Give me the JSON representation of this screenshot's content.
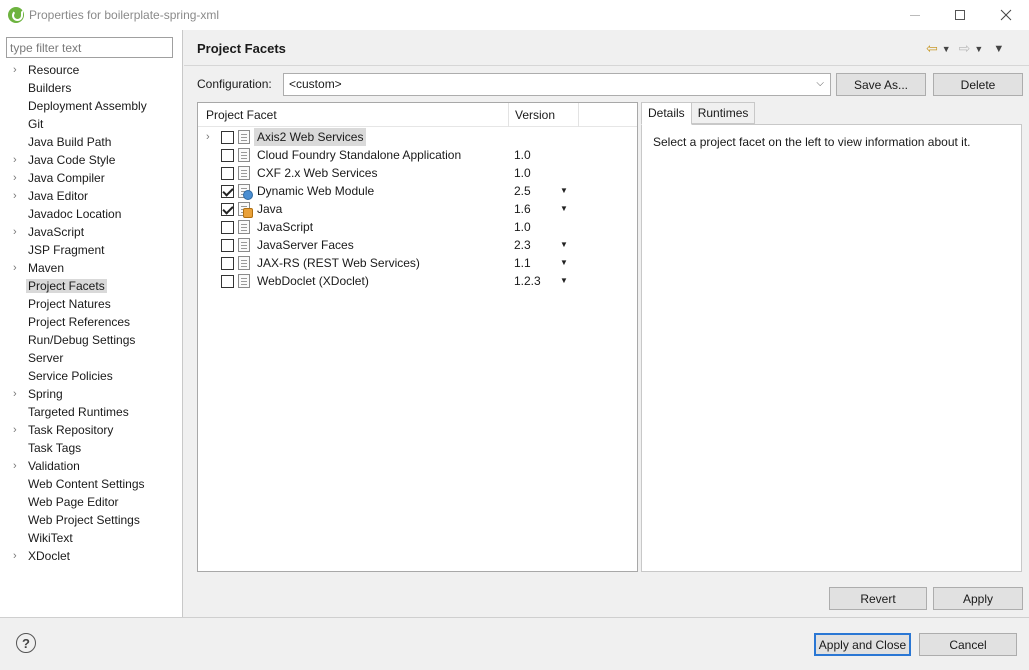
{
  "window": {
    "title": "Properties for boilerplate-spring-xml"
  },
  "sidebar": {
    "filter_placeholder": "type filter text",
    "items": [
      {
        "label": "Resource",
        "expandable": true
      },
      {
        "label": "Builders",
        "expandable": false
      },
      {
        "label": "Deployment Assembly",
        "expandable": false
      },
      {
        "label": "Git",
        "expandable": false
      },
      {
        "label": "Java Build Path",
        "expandable": false
      },
      {
        "label": "Java Code Style",
        "expandable": true
      },
      {
        "label": "Java Compiler",
        "expandable": true
      },
      {
        "label": "Java Editor",
        "expandable": true
      },
      {
        "label": "Javadoc Location",
        "expandable": false
      },
      {
        "label": "JavaScript",
        "expandable": true
      },
      {
        "label": "JSP Fragment",
        "expandable": false
      },
      {
        "label": "Maven",
        "expandable": true
      },
      {
        "label": "Project Facets",
        "expandable": false,
        "selected": true
      },
      {
        "label": "Project Natures",
        "expandable": false
      },
      {
        "label": "Project References",
        "expandable": false
      },
      {
        "label": "Run/Debug Settings",
        "expandable": false
      },
      {
        "label": "Server",
        "expandable": false
      },
      {
        "label": "Service Policies",
        "expandable": false
      },
      {
        "label": "Spring",
        "expandable": true
      },
      {
        "label": "Targeted Runtimes",
        "expandable": false
      },
      {
        "label": "Task Repository",
        "expandable": true
      },
      {
        "label": "Task Tags",
        "expandable": false
      },
      {
        "label": "Validation",
        "expandable": true
      },
      {
        "label": "Web Content Settings",
        "expandable": false
      },
      {
        "label": "Web Page Editor",
        "expandable": false
      },
      {
        "label": "Web Project Settings",
        "expandable": false
      },
      {
        "label": "WikiText",
        "expandable": false
      },
      {
        "label": "XDoclet",
        "expandable": true
      }
    ]
  },
  "main": {
    "title": "Project Facets",
    "configuration_label": "Configuration:",
    "configuration_value": "<custom>",
    "save_as_label": "Save As...",
    "delete_label": "Delete",
    "table": {
      "col_facet": "Project Facet",
      "col_version": "Version",
      "rows": [
        {
          "name": "Axis2 Web Services",
          "version": "",
          "checked": false,
          "expandable": true,
          "selected": true,
          "icon": "facet-icon",
          "dropdown": false
        },
        {
          "name": "Cloud Foundry Standalone Application",
          "version": "1.0",
          "checked": false,
          "expandable": false,
          "icon": "facet-icon",
          "dropdown": false
        },
        {
          "name": "CXF 2.x Web Services",
          "version": "1.0",
          "checked": false,
          "expandable": false,
          "icon": "facet-icon",
          "dropdown": false
        },
        {
          "name": "Dynamic Web Module",
          "version": "2.5",
          "checked": true,
          "expandable": false,
          "icon": "web-module-icon",
          "dropdown": true
        },
        {
          "name": "Java",
          "version": "1.6",
          "checked": true,
          "expandable": false,
          "icon": "java-facet-icon",
          "dropdown": true
        },
        {
          "name": "JavaScript",
          "version": "1.0",
          "checked": false,
          "expandable": false,
          "icon": "facet-icon",
          "dropdown": false
        },
        {
          "name": "JavaServer Faces",
          "version": "2.3",
          "checked": false,
          "expandable": false,
          "icon": "facet-icon",
          "dropdown": true
        },
        {
          "name": "JAX-RS (REST Web Services)",
          "version": "1.1",
          "checked": false,
          "expandable": false,
          "icon": "facet-icon",
          "dropdown": true
        },
        {
          "name": "WebDoclet (XDoclet)",
          "version": "1.2.3",
          "checked": false,
          "expandable": false,
          "icon": "facet-icon",
          "dropdown": true
        }
      ]
    },
    "details": {
      "tab_details": "Details",
      "tab_runtimes": "Runtimes",
      "text": "Select a project facet on the left to view information about it."
    },
    "revert_label": "Revert",
    "apply_label": "Apply"
  },
  "footer": {
    "help_symbol": "?",
    "apply_close_label": "Apply and Close",
    "cancel_label": "Cancel"
  }
}
